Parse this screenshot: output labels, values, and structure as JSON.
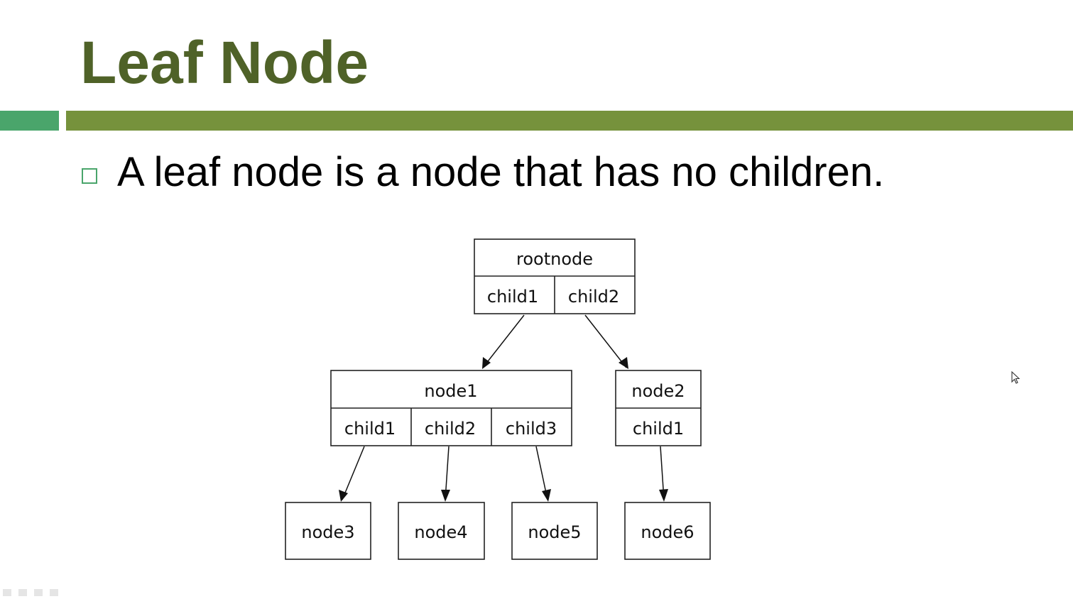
{
  "slide": {
    "title": "Leaf Node",
    "bullet": "A leaf node is a node that has no children."
  },
  "colors": {
    "title": "#4f6228",
    "accent_bar": "#76923c",
    "accent_bar_left": "#4aa56b",
    "bullet_box": "#4aa56b"
  },
  "diagram": {
    "nodes": {
      "rootnode": {
        "label": "rootnode",
        "ports": [
          "child1",
          "child2"
        ]
      },
      "node1": {
        "label": "node1",
        "ports": [
          "child1",
          "child2",
          "child3"
        ]
      },
      "node2": {
        "label": "node2",
        "ports": [
          "child1"
        ]
      },
      "node3": {
        "label": "node3"
      },
      "node4": {
        "label": "node4"
      },
      "node5": {
        "label": "node5"
      },
      "node6": {
        "label": "node6"
      }
    },
    "edges": [
      {
        "from": "rootnode.child1",
        "to": "node1"
      },
      {
        "from": "rootnode.child2",
        "to": "node2"
      },
      {
        "from": "node1.child1",
        "to": "node3"
      },
      {
        "from": "node1.child2",
        "to": "node4"
      },
      {
        "from": "node1.child3",
        "to": "node5"
      },
      {
        "from": "node2.child1",
        "to": "node6"
      }
    ]
  },
  "icons": {
    "cursor": "mouse-pointer-icon",
    "bullet": "hollow-square-bullet-icon"
  }
}
